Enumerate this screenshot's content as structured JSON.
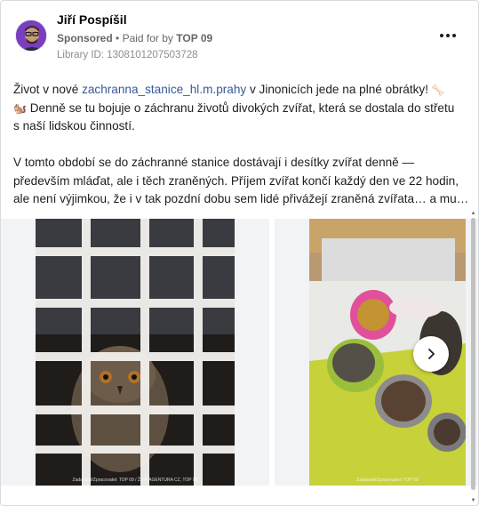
{
  "post": {
    "author": "Jiří Pospíšil",
    "sponsored": "Sponsored",
    "separator": "•",
    "paid_prefix": "Paid for by",
    "paid_by": "TOP 09",
    "library_id": "Library ID: 1308101207503728",
    "more_icon": "more-horizontal-icon"
  },
  "body": {
    "line1_before": "Život v nové ",
    "line1_link": "zachranna_stanice_hl.m.prahy",
    "line1_after": " v Jinonicích jede na plné obrátky! ",
    "line1_emoji": "🦴",
    "line2_emoji": "🐿️",
    "line2_text": " Denně se tu bojuje o záchranu životů divokých zvířat, která se dostala do střetu",
    "line3": "s naší lidskou činností.",
    "line4": "V tomto období se do záchranné stanice dostávají i desítky zvířat denně —",
    "line5": "především mláďat, ale i těch zraněných. Příjem zvířat končí každý den ve 22 hodin,",
    "line6": "ale není výjimkou, že i v tak pozdní dobu sem lidé přivážejí zraněná zvířata… a mu…"
  },
  "carousel": {
    "slide1_caption": "Zadavatel/Zpracovatel: TOP 09 / ŽIVÁ AGENTURA CZ, TOP 09",
    "slide2_caption": "Zadavatel/Zpracovatel: TOP 09",
    "next_icon": "chevron-right-icon"
  }
}
